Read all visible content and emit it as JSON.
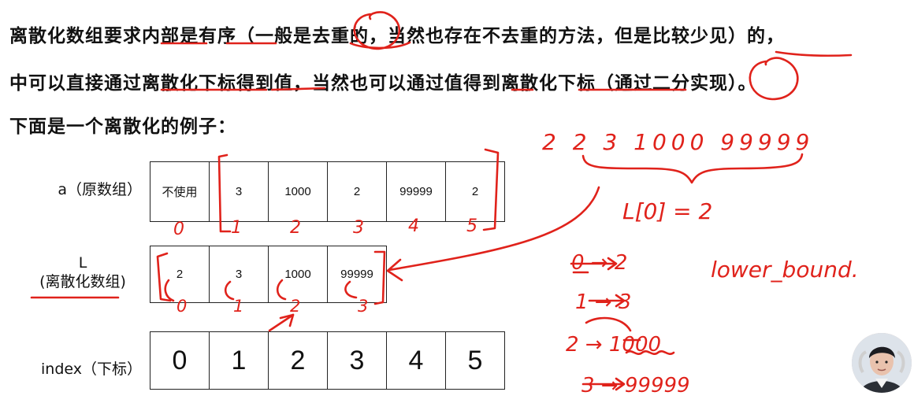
{
  "text": {
    "line1": "离散化数组要求内部是有序（一般是去重的，当然也存在不去重的方法，但是比较少见）的，",
    "line2": "中可以直接通过离散化下标得到值，当然也可以通过值得到离散化下标（通过二分实现）。",
    "line3": "下面是一个离散化的例子："
  },
  "arrays": {
    "a_label": "a（原数组）",
    "a_cells": [
      "不使用",
      "3",
      "1000",
      "2",
      "99999",
      "2"
    ],
    "L_label_top": "L",
    "L_label_bottom": "(离散化数组)",
    "L_cells": [
      "2",
      "3",
      "1000",
      "99999"
    ],
    "index_label": "index（下标）",
    "index_cells": [
      "0",
      "1",
      "2",
      "3",
      "4",
      "5"
    ]
  },
  "handwriting": {
    "a_indices": [
      "0",
      "1",
      "2",
      "3",
      "4",
      "5"
    ],
    "L_indices": [
      "0",
      "1",
      "2",
      "3"
    ],
    "top_sequence": "2 2 3 1000 99999",
    "equation": "L[0] = 2",
    "mapping": [
      "0 → 2",
      "1 → 3",
      "2 → 1000",
      "3 → 99999"
    ],
    "note": "lower_bound."
  },
  "colors": {
    "ink": "#e0221b",
    "text": "#111111",
    "border": "#222222"
  }
}
